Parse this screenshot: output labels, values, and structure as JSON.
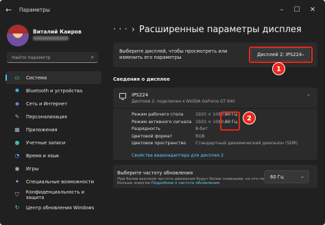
{
  "window": {
    "title": "Параметры",
    "back_icon": "←",
    "min_icon": "–",
    "max_icon": "☐",
    "close_icon": "✕"
  },
  "user": {
    "name": "Виталий Каиров"
  },
  "search": {
    "placeholder": "Найти параметр",
    "icon": "⌕"
  },
  "nav": [
    {
      "label": "Система",
      "icon": "monitor",
      "glyph": "▭",
      "color": "#4cc2ff",
      "active": true
    },
    {
      "label": "Bluetooth и устройства",
      "icon": "bluetooth",
      "glyph": "✱",
      "color": "#4cc2ff"
    },
    {
      "label": "Сеть и Интернет",
      "icon": "network",
      "glyph": "◈",
      "color": "#8ab4f8"
    },
    {
      "label": "Персонализация",
      "icon": "brush",
      "glyph": "✎",
      "color": "#f0a35c"
    },
    {
      "label": "Приложения",
      "icon": "apps",
      "glyph": "▦",
      "color": "#9fb4d8"
    },
    {
      "label": "Учетные записи",
      "icon": "person",
      "glyph": "●",
      "color": "#37c1a1"
    },
    {
      "label": "Время и язык",
      "icon": "globe-clock",
      "glyph": "◔",
      "color": "#58a6ff"
    },
    {
      "label": "Игры",
      "icon": "gamepad",
      "glyph": "◉",
      "color": "#b8b8b8"
    },
    {
      "label": "Специальные возможности",
      "icon": "accessibility",
      "glyph": "✦",
      "color": "#7fb0ff"
    },
    {
      "label": "Конфиденциальность и защита",
      "icon": "shield",
      "glyph": "⛉",
      "color": "#b8b8b8"
    },
    {
      "label": "Центр обновления Windows",
      "icon": "update",
      "glyph": "↻",
      "color": "#4cc2ff"
    }
  ],
  "breadcrumb": {
    "dots": "· · ·",
    "sep": "›",
    "title": "Расширенные параметры дисплея"
  },
  "select_display": {
    "text": "Выберите дисплей, чтобы просмотреть или изменить его параметры",
    "value": "Дисплей 2: IPS224",
    "chevron": "⌄"
  },
  "section_title": "Сведения о дисплее",
  "display_info": {
    "name": "IPS224",
    "subtitle": "Дисплей 2: подключен к NVIDIA GeForce GT 640",
    "collapse_chevron": "⌃",
    "rows": [
      {
        "label": "Режим рабочего стола",
        "value": "1920 × 1080,",
        "hz": "60 Гц"
      },
      {
        "label": "Режим активного сигнала",
        "value": "1920 × 1080,",
        "hz": "60 Гц"
      },
      {
        "label": "Разрядность",
        "value": "8-бит"
      },
      {
        "label": "Цветовой формат",
        "value": "RGB"
      },
      {
        "label": "Цветовое пространство",
        "value": "Стандартный динамический диапазон (SDR)"
      }
    ],
    "adapter_link": "Свойства видеоадаптера для дисплея 2"
  },
  "refresh": {
    "title": "Выберите частоту обновления",
    "desc": "При более высокой частоте движения будут более плавными, но это потребляет",
    "desc2_text": "больше энергии",
    "desc2_link": "Подробнее о частоте обновления",
    "value": "60 Гц",
    "chevron": "⌄"
  },
  "annotations": {
    "badge1": "1",
    "badge2": "2",
    "color": "#e8281c"
  }
}
